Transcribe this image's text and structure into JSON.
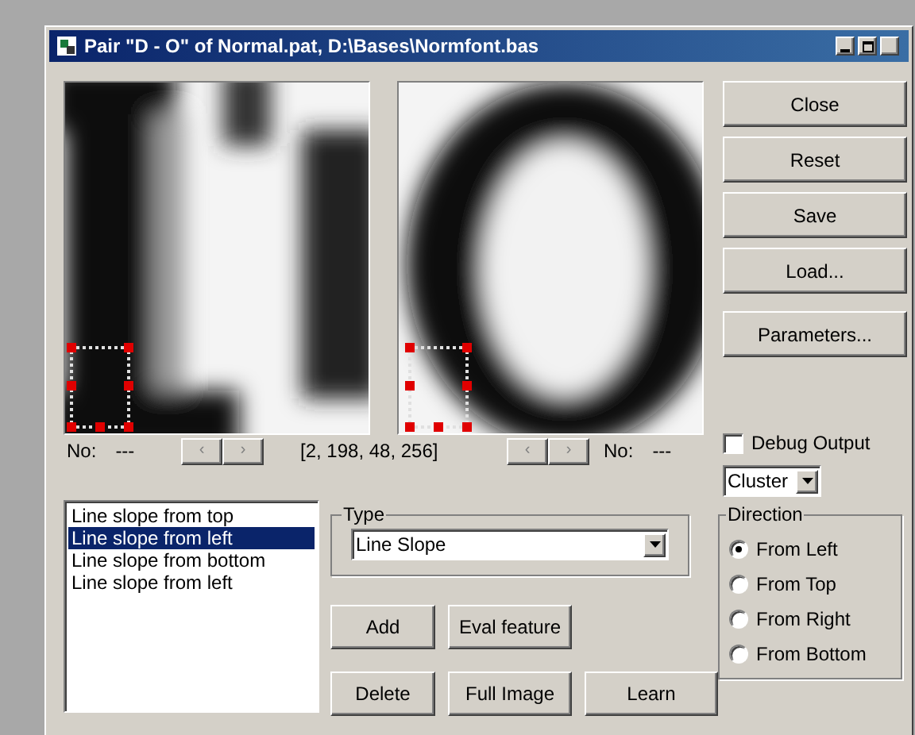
{
  "window": {
    "title": "Pair \"D - O\" of Normal.pat, D:\\Bases\\Normfont.bas"
  },
  "panels": [
    {
      "kind": "picture",
      "number_label": "No:",
      "number_value": "---"
    },
    {
      "kind": "picture",
      "number_label": "No:",
      "number_value": "---"
    }
  ],
  "nav_buttons": [
    "‹",
    "›"
  ],
  "coordinates": "[2, 198, 48, 256]",
  "side_buttons": [
    "Close",
    "Reset",
    "Save",
    "Load...",
    "Parameters..."
  ],
  "debug_output": {
    "label": "Debug Output",
    "checked": false
  },
  "cluster_select": {
    "value": "Cluster"
  },
  "features": [
    {
      "label": "Line slope from top",
      "selected": false
    },
    {
      "label": "Line slope from left",
      "selected": true
    },
    {
      "label": "Line slope from bottom",
      "selected": false
    },
    {
      "label": "Line slope from left",
      "selected": false
    }
  ],
  "type_group": {
    "title": "Type",
    "value": "Line Slope"
  },
  "action_buttons": [
    "Add",
    "Eval feature",
    "Delete",
    "Full Image",
    "Learn"
  ],
  "direction": {
    "title": "Direction",
    "options": [
      {
        "label": "From Left",
        "selected": true
      },
      {
        "label": "From Top",
        "selected": false
      },
      {
        "label": "From Right",
        "selected": false
      },
      {
        "label": "From Bottom",
        "selected": false
      }
    ]
  }
}
